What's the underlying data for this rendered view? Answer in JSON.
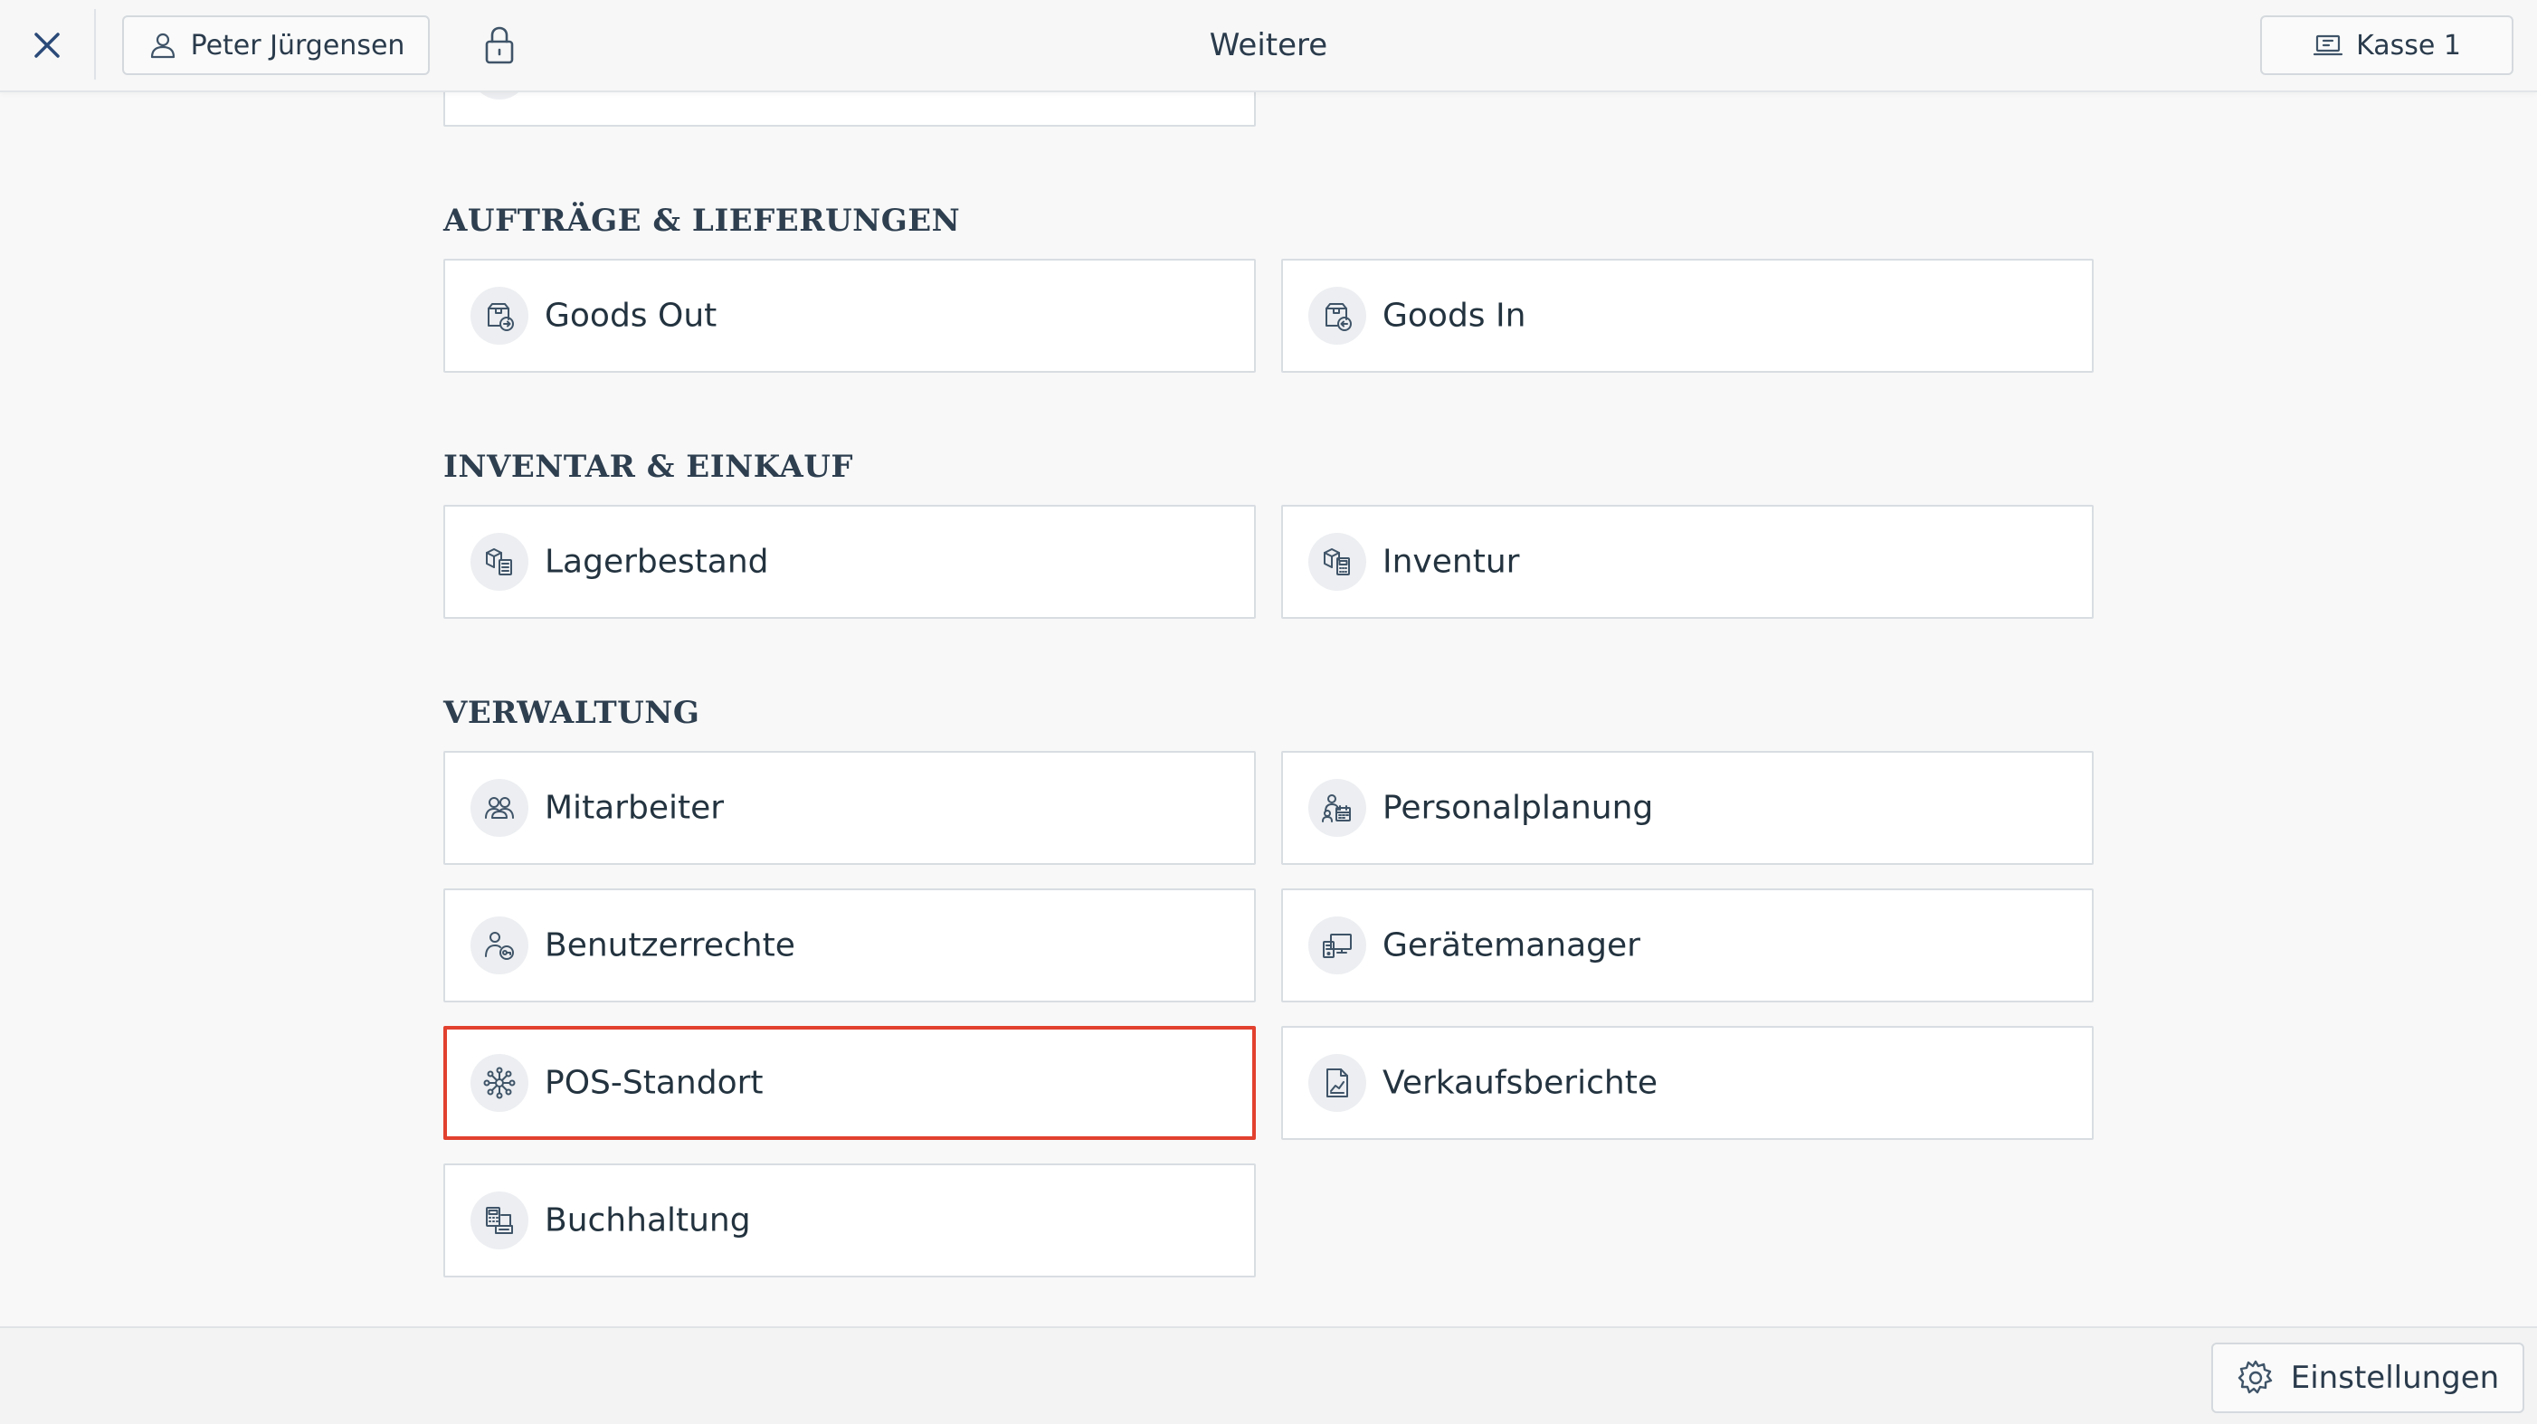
{
  "header": {
    "title": "Weitere",
    "user_name": "Peter Jürgensen",
    "register_label": "Kasse 1",
    "close_icon": "close-icon",
    "lock_icon": "lock-icon"
  },
  "sections": [
    {
      "heading": "AUFTRÄGE & LIEFERUNGEN",
      "items": [
        {
          "label": "Goods Out",
          "icon": "goods-out-icon"
        },
        {
          "label": "Goods In",
          "icon": "goods-in-icon"
        }
      ]
    },
    {
      "heading": "INVENTAR & EINKAUF",
      "items": [
        {
          "label": "Lagerbestand",
          "icon": "stock-icon"
        },
        {
          "label": "Inventur",
          "icon": "inventory-icon"
        }
      ]
    },
    {
      "heading": "VERWALTUNG",
      "items": [
        {
          "label": "Mitarbeiter",
          "icon": "employees-icon"
        },
        {
          "label": "Personalplanung",
          "icon": "staff-planning-icon"
        },
        {
          "label": "Benutzerrechte",
          "icon": "user-rights-icon"
        },
        {
          "label": "Gerätemanager",
          "icon": "device-manager-icon"
        },
        {
          "label": "POS-Standort",
          "icon": "pos-location-icon",
          "highlighted": true
        },
        {
          "label": "Verkaufsberichte",
          "icon": "sales-reports-icon"
        },
        {
          "label": "Buchhaltung",
          "icon": "accounting-icon"
        }
      ]
    }
  ],
  "footer": {
    "settings_label": "Einstellungen"
  },
  "colors": {
    "highlight": "#e2412f",
    "icon_stroke": "#3f5468",
    "accent_blue": "#2b4a78"
  }
}
